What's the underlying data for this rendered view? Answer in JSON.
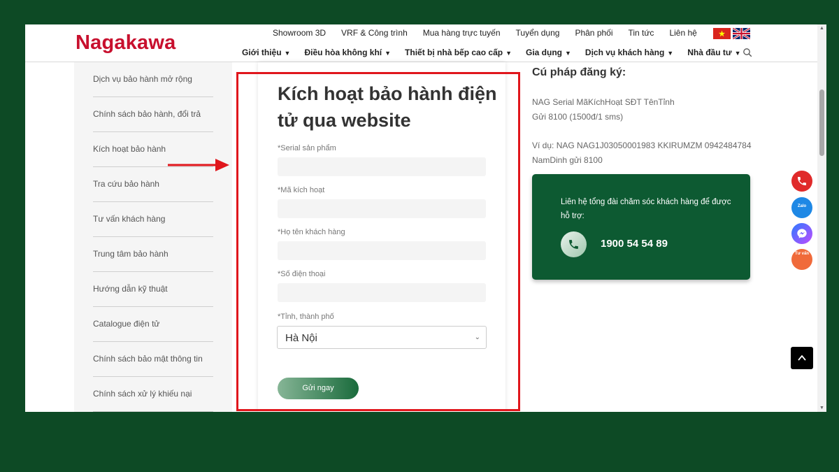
{
  "header": {
    "logo": "Nagakawa",
    "top_nav": [
      "Showroom 3D",
      "VRF & Công trình",
      "Mua hàng trực tuyến",
      "Tuyển dụng",
      "Phân phối",
      "Tin tức",
      "Liên hệ"
    ],
    "main_nav": [
      "Giới thiệu",
      "Điều hòa không khí",
      "Thiết bị nhà bếp cao cấp",
      "Gia dụng",
      "Dịch vụ khách hàng",
      "Nhà đầu tư"
    ],
    "caret": "▼"
  },
  "sidebar": {
    "items": [
      "Dịch vụ bảo hành mở rộng",
      "Chính sách bảo hành, đổi trả",
      "Kích hoạt bảo hành",
      "Tra cứu bảo hành",
      "Tư vấn khách hàng",
      "Trung tâm bảo hành",
      "Hướng dẫn kỹ thuật",
      "Catalogue điện tử",
      "Chính sách bảo mật thông tin",
      "Chính sách xử lý khiếu nại"
    ]
  },
  "form": {
    "title": "Kích hoạt bảo hành điện tử qua website",
    "fields": [
      {
        "label": "*Serial sản phẩm",
        "value": ""
      },
      {
        "label": "*Mã kích hoạt",
        "value": ""
      },
      {
        "label": "*Họ tên khách hàng",
        "value": ""
      },
      {
        "label": "*Số điện thoại",
        "value": ""
      }
    ],
    "province_label": "*Tỉnh, thành phố",
    "province_value": "Hà Nội",
    "submit_label": "Gửi ngay"
  },
  "syntax": {
    "title": "Cú pháp đăng ký:",
    "line1": "NAG Serial MãKíchHoạt SĐT TênTỉnh",
    "line2": "Gửi 8100 (1500đ/1 sms)",
    "line3": "Ví dụ: NAG NAG1J03050001983 KKIRUMZM 0942484784",
    "line4": "NamDinh gửi 8100"
  },
  "contact": {
    "text": "Liên hệ tổng đài chăm sóc khách hàng để được hỗ trợ:",
    "hotline": "1900 54 54 89"
  },
  "floating": {
    "zalo": "Zalo",
    "tuvan": "Tư vấn"
  },
  "colors": {
    "brand_red": "#c8102e",
    "brand_green": "#0d5a32",
    "highlight_red": "#e0161c",
    "background": "#0d4a25"
  }
}
